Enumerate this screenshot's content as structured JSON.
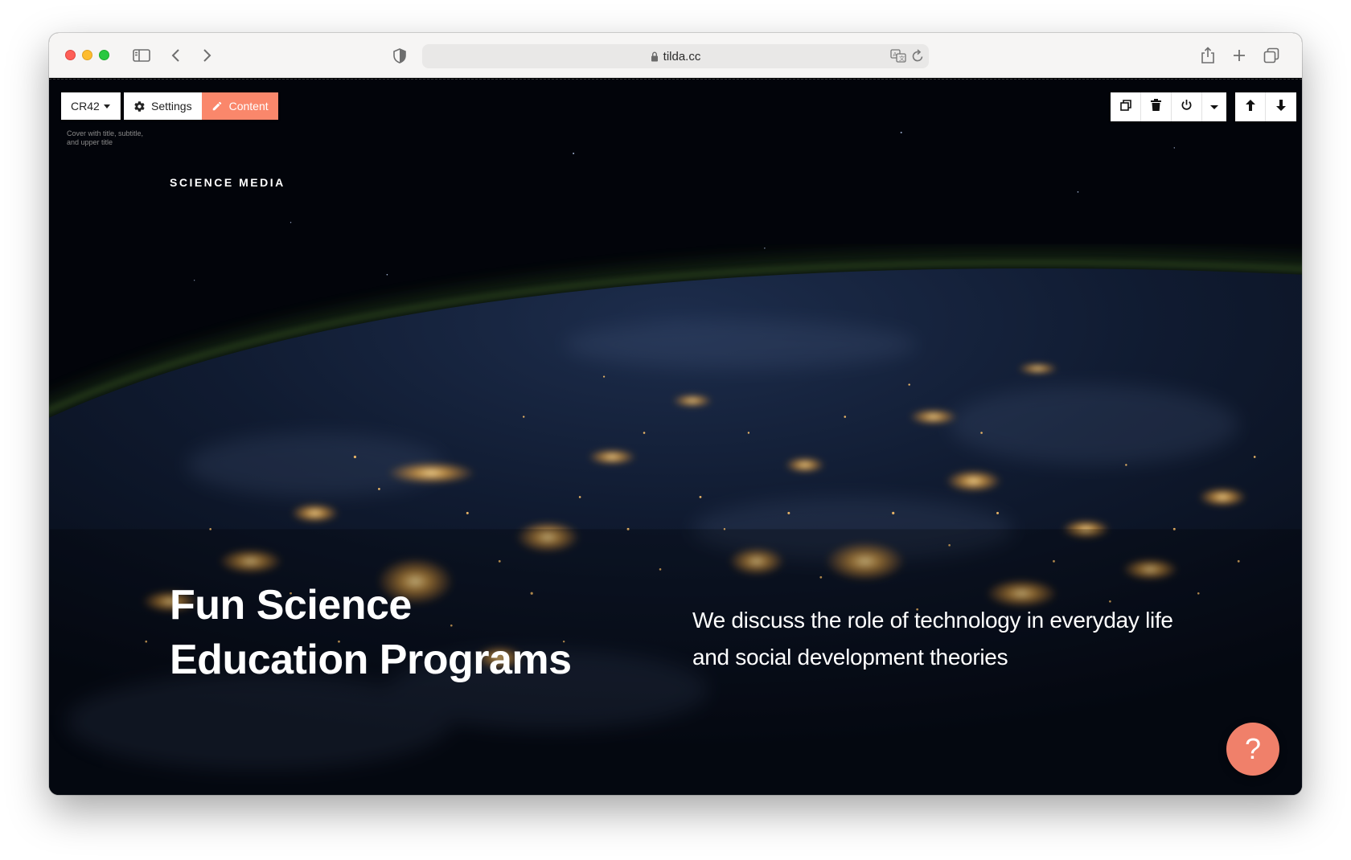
{
  "browser": {
    "address": "tilda.cc"
  },
  "editor": {
    "block_code": "CR42",
    "settings_label": "Settings",
    "content_label": "Content",
    "block_description": "Cover with title, subtitle, and upper title",
    "accent_color": "#fa876b"
  },
  "cover": {
    "upper_title": "SCIENCE MEDIA",
    "title_line1": "Fun Science",
    "title_line2": "Education Programs",
    "subtitle_line1": "We discuss the role of technology in everyday life",
    "subtitle_line2": "and social development theories"
  },
  "help": {
    "label": "?"
  }
}
